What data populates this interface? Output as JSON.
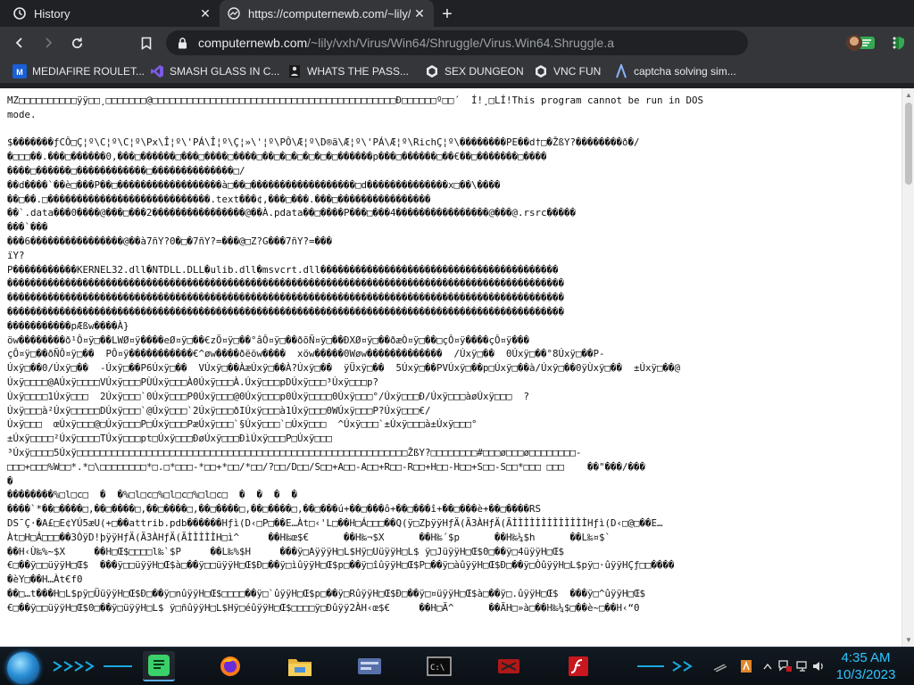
{
  "tabs": [
    {
      "title": "History",
      "icon": "history-icon"
    },
    {
      "title": "https://computernewb.com/~lily/v",
      "icon": "page-icon"
    }
  ],
  "toolbar": {
    "url_host": "computernewb.com",
    "url_path": "/~lily/vxh/Virus/Win64/Shruggle/Virus.Win64.Shruggle.a"
  },
  "bookmarks": [
    {
      "label": "MEDIAFIRE ROULET...",
      "icon": "mediafire-icon"
    },
    {
      "label": "SMASH GLASS IN C...",
      "icon": "visualstudio-icon"
    },
    {
      "label": "WHATS THE PASS...",
      "icon": "figure-icon"
    },
    {
      "label": "SEX DUNGEON",
      "icon": "vmware-icon"
    },
    {
      "label": "VNC FUN",
      "icon": "vmware-icon"
    },
    {
      "label": "captcha solving sim...",
      "icon": "captcha-icon"
    }
  ],
  "content": {
    "lines": [
      "MZ□□□□□□□□□□ÿÿ□□¸□□□□□□□@□□□□□□□□□□□□□□□□□□□□□□□□□□□□□□□□□□□□□□□□□□Ð□□□□□□º□□´  Í!¸□LÍ!This program cannot be run in DOS",
      "mode.",
      "",
      "$�������ƒCÔ□Ç¦º\\C¦º\\C¦º\\Px\\Î¦º\\'PÁ\\Î¦º\\Ç¦»\\'¦º\\PÔ\\Æ¦º\\D®ä\\Æ¦º\\'PÁ\\Æ¦º\\RichÇ¦º\\��������PE��d†□�ŽßY?��������ð�/",
      "�□□□��.���□������0,���□������□���□����□����□��□�□�□�□�□�□������p���□������□��€��□�������□����",
      "����□������□������������□��������������□/",
      "��d����`��è□���P��□������������������à□��□������������������□d��������������x□��\\����",
      "��□��.□����������������������������.text���¢,���□���.���□����������������",
      "��`.data���0����@���□���2����������������@��À.pdata��□����P���□���4����������������@���@.rsrc�����",
      "���`���",
      "���6����������������@��à7ñY?0�□�7ñY?=���@□Z?G���7ñY?=���",
      "ïY?",
      "P�����������KERNEL32.dll�NTDLL.DLL�ulib.dll�msvcrt.dll�����������������������������������������",
      "������������������������������������������������������������������������������������������������",
      "������������������������������������������������������������������������������������������������",
      "������������������������������������������������������������������������������������������������",
      "�����������pÆßw����À}",
      "öw��������ð¹Ô¤ÿ□��LWØ¤ÿ����eØ¤ÿ□��€zÖ¤ÿ□��°âÔ¤ÿ□��ðõÑ¤ÿ□��ÐXØ¤ÿ□��ðæÒ¤ÿ□��□çÔ¤ÿ����çÔ¤ÿ���",
      "çÔ¤ÿ□��ðÑÔ¤ÿ□��  PÔ¤ÿ�����������€^øw����ðëöw����  xöw�����0Wøw�������������  /Úxÿ□��  0Úxÿ□��°8Úxÿ□��P-",
      "Úxÿ□��0/Úxÿ□��  -Úxÿ□��P6Úxÿ□��  VÚxÿ□��ÀæÚxÿ□��À?Úxÿ□��  ÿÜxÿ□��  5Úxÿ□��PVÚxÿ□��p□Úxÿ□��à/Úxÿ□��0ÿÙxÿ□��  ±Úxÿ□��@",
      "Úxÿ□□□□@AÚxÿ□□□□VÚxÿ□□□PÙÚxÿ□□□À0Úxÿ□□□À.Úxÿ□□□pDÚxÿ□□□³Úxÿ□□□p?",
      "Úxÿ□□□□1Úxÿ□□□  2Úxÿ□□□`0Úxÿ□□□P0Úxÿ□□□@0Úxÿ□□□p0Úxÿ□□□□0Úxÿ□□□°/Úxÿ□□□Ð/Úxÿ□□□àøÚxÿ□□□  ?",
      "Úxÿ□□□à²Úxÿ□□□□□DÚxÿ□□□`@Úxÿ□□□`2Úxÿ□□□ðIÚxÿ□□□à1Úxÿ□□□0WÚxÿ□□□P?Úxÿ□□□€/",
      "Úxÿ□□□  œÚxÿ□□□@□Úxÿ□□□P□Úxÿ□□□PæÚxÿ□□□`§Úxÿ□□□`□Úxÿ□□□  ^Úxÿ□□□`±Úxÿ□□□à±Úxÿ□□□°",
      "±Úxÿ□□□□²Úxÿ□□□□TÚxÿ□□□pt□Úxÿ□□□ÐøÚxÿ□□□ÐìÚxÿ□□□P□Úxÿ□□□",
      "³Úxÿ□□□□5Úxÿ□□□□□□□□□□□□□□□□□□□□□□□□□□□□□□□□□□□□□□□□□□□□□□□□□□□□□□□□□ŽßY?□□□□□□□□#□□□ø□□□ø□□□□□□□□-",
      "□□□+□□□%W□□*.*□\\□□□□□□□□*□.□*□□□-*□□+*□□/*□□/?□□/D□□/S□□+A□□-A□□+R□□-R□□+H□□-H□□+S□□-S□□*□□□ □□□    ��\"���/���",
      "�",
      "��������%□l□c□  �  �%□l□c□%□l□c□%□l□c□  �  �  �  �",
      "����`*��□����□,��□����□,��□����□,��□����□,��□����□,��□���ú+��□���ô+��□���î+��□���è+��□����RS",
      "DS¯Ç·�A£□E¢YÚ5æU(+□��attrib.pdb������Hƒì(D‹□P□��E…Àt□‹'L□��H□Á□□□��Q(ÿ□ZþÿÿHƒÄ(Ã3ÀHƒÄ(ÃÌÌÌÌÌÌÌÌÌÌÌÌÌHƒì(D‹□@□��E…",
      "Àt□H□Á□□□��3ÒÿD!þÿÿHƒÄ(Ã3ÀHƒÄ(ÃÌÌÌÌÌH□ì^     ��H‰œ$€      ��H‰¬$X      ��H‰´$p      ��H‰¼$h      ��L‰¤$`",
      "��H‹Ù‰%~$X     ��H□Œ$□□□□l‰`$P     ��L‰%$H     ���ÿ□AÿÿÿH□L$Hÿ□UüÿÿH□L$ ÿ□JüÿÿH□Œ$0□��ÿ□4üÿÿH□Œ$",
      "€□��ÿ□□üÿÿH□Œ$  ���ÿ□□üÿÿH□Œ$à□��ÿ□□üÿÿH□Œ$Ð□��ÿ□ìûÿÿH□Œ$p□��ÿ□îûÿÿH□Œ$P□��ÿ□àûÿÿH□Œ$Ð□��ÿ□ÒûÿÿH□L$pÿ□·ûÿÿHÇƒ□□����",
      "�èY□��H…Àt€f0",
      "��□…t���H□L$pÿ□ÜüÿÿH□Œ$Ð□��ÿ□nûÿÿH□Œ$□□□□��ÿ□`ûÿÿH□Œ$p□��ÿ□RûÿÿH□Œ$Ð□��ÿ□¤üÿÿH□Œ$à□��ÿ□.ûÿÿH□Œ$  ���ÿ□^ûÿÿH□Œ$",
      "€□��ÿ□□üÿÿH□Œ$0□��ÿ□üÿÿH□L$ ÿ□ñûÿÿH□L$Hÿ□éûÿÿH□Œ$□□□□ÿ□Ðûÿÿ2ÀH‹œ$€     ��H□Ä^      ��ÃH□»à□��H‰¼$□��è~□��H‹“0"
    ]
  },
  "taskbar": {
    "apps": [
      "notepad-icon",
      "firefox-icon",
      "explorer-icon",
      "control-panel-icon",
      "cmd-icon",
      "media-icon",
      "flash-icon"
    ],
    "clock_time": "4:35 AM",
    "clock_date": "10/3/2023"
  },
  "colors": {
    "chrome_dark": "#202124",
    "chrome_toolbar": "#35363a",
    "accent_blue": "#2ec5ff"
  }
}
